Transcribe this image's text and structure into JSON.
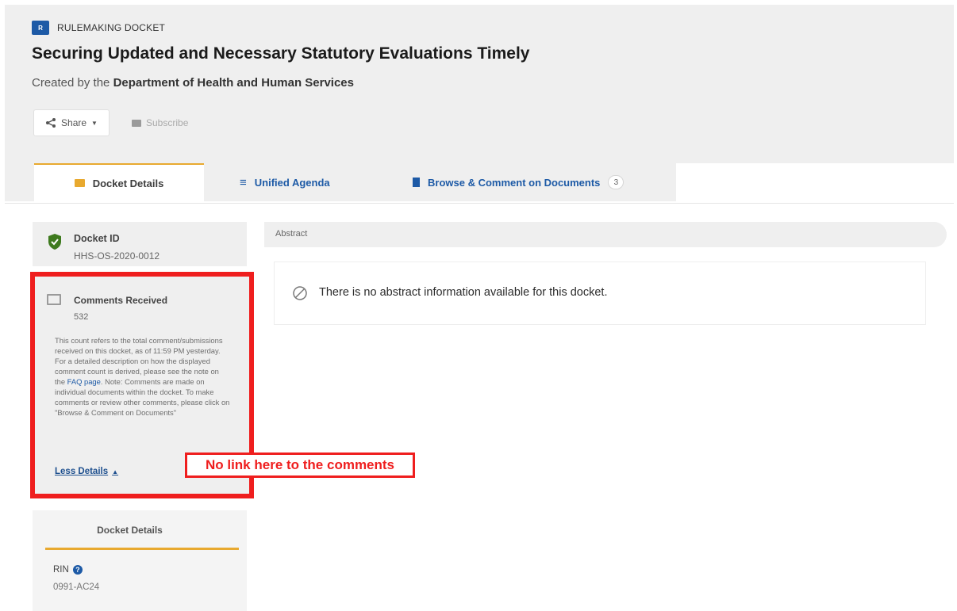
{
  "header": {
    "type_badge": "R",
    "type_label": "RULEMAKING DOCKET",
    "title": "Securing Updated and Necessary Statutory Evaluations Timely",
    "byline_prefix": "Created by the",
    "byline_agency": "Department of Health and Human Services",
    "share_label": "Share",
    "subscribe_label": "Subscribe"
  },
  "tabs": [
    {
      "label": "Docket Details"
    },
    {
      "label": "Unified Agenda"
    },
    {
      "label": "Browse & Comment on Documents",
      "count": "3"
    }
  ],
  "sidebar": {
    "docket_id_label": "Docket ID",
    "docket_id_value": "HHS-OS-2020-0012",
    "comments_label": "Comments Received",
    "comments_count": "532",
    "comments_text_1": "This count refers to the total comment/submissions received on this docket, as of 11:59 PM yesterday. For a detailed description on how the displayed comment count is derived, please see the note on the ",
    "comments_text_link": "FAQ page",
    "comments_text_2": ". Note: Comments are made on individual documents within the docket. To make comments or review other comments, please click on \"Browse & Comment on Documents\"",
    "less_details": "Less Details",
    "details_title": "Docket Details",
    "rin_label": "RIN",
    "rin_value": "0991-AC24"
  },
  "annotation": {
    "callout_text": "No link here to the comments"
  },
  "main": {
    "abstract_label": "Abstract",
    "no_abstract_text": "There is no abstract information available for this docket."
  }
}
